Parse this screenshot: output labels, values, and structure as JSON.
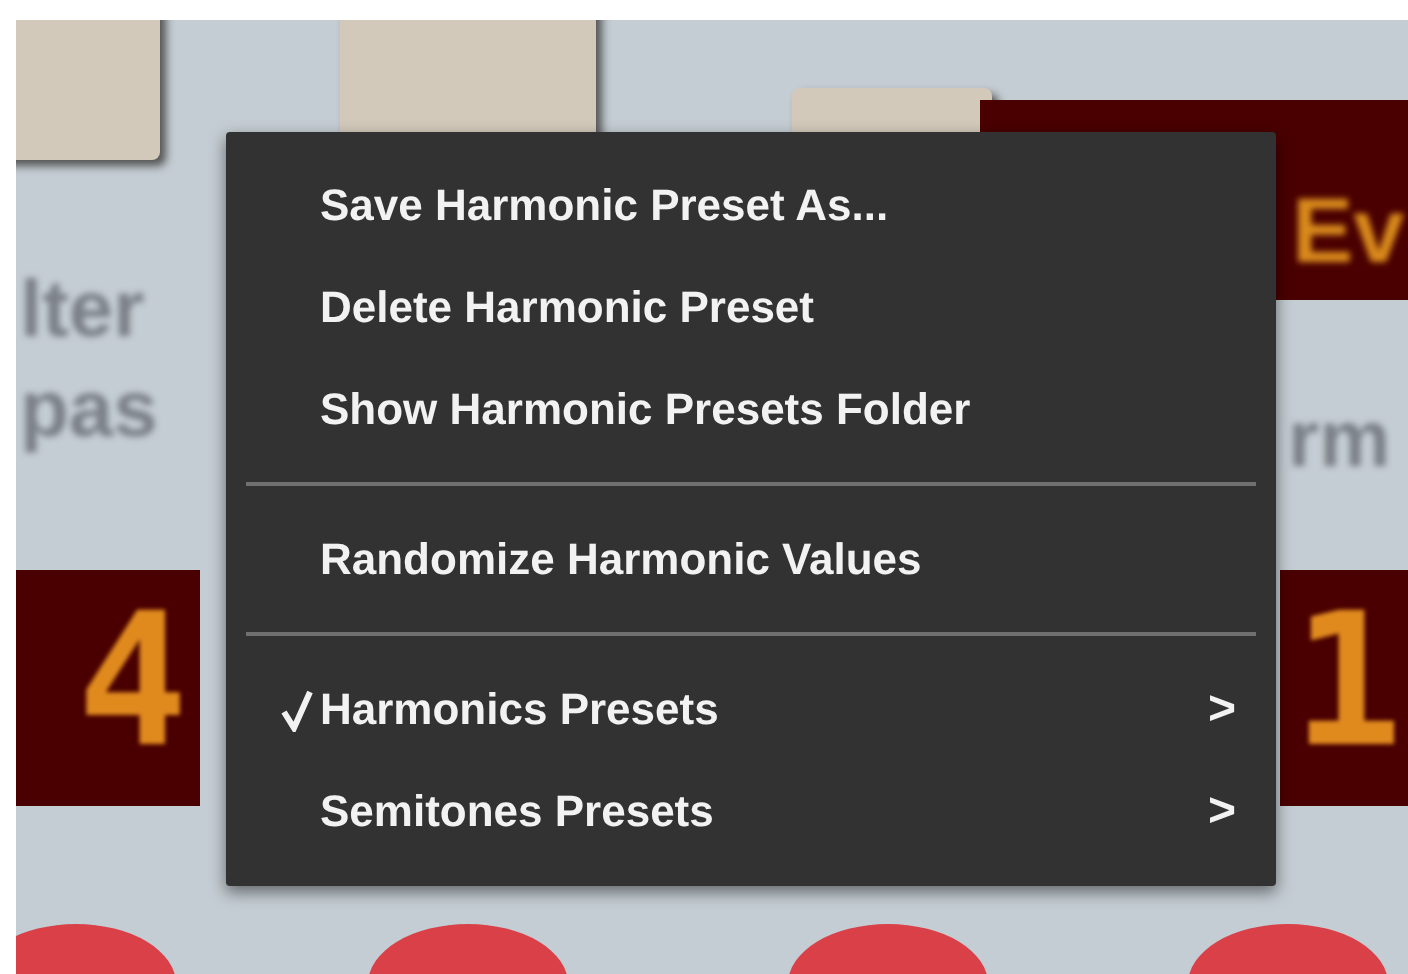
{
  "panel": {
    "labels": [
      {
        "text": "lter"
      },
      {
        "text": "pas"
      },
      {
        "text": "Ev",
        "kind": "display"
      },
      {
        "text": "rm"
      }
    ],
    "displays": [
      {
        "text": "4"
      },
      {
        "text": "1"
      }
    ]
  },
  "context_menu": {
    "items": [
      {
        "kind": "item",
        "label": "Save Harmonic Preset As...",
        "checked": false
      },
      {
        "kind": "item",
        "label": "Delete Harmonic Preset",
        "checked": false
      },
      {
        "kind": "item",
        "label": "Show Harmonic Presets Folder",
        "checked": false
      },
      {
        "kind": "separator"
      },
      {
        "kind": "item",
        "label": "Randomize Harmonic Values",
        "checked": false
      },
      {
        "kind": "separator"
      },
      {
        "kind": "submenu",
        "label": "Harmonics Presets",
        "checked": true,
        "arrow": ">"
      },
      {
        "kind": "submenu",
        "label": "Semitones Presets",
        "checked": false,
        "arrow": ">"
      }
    ]
  }
}
